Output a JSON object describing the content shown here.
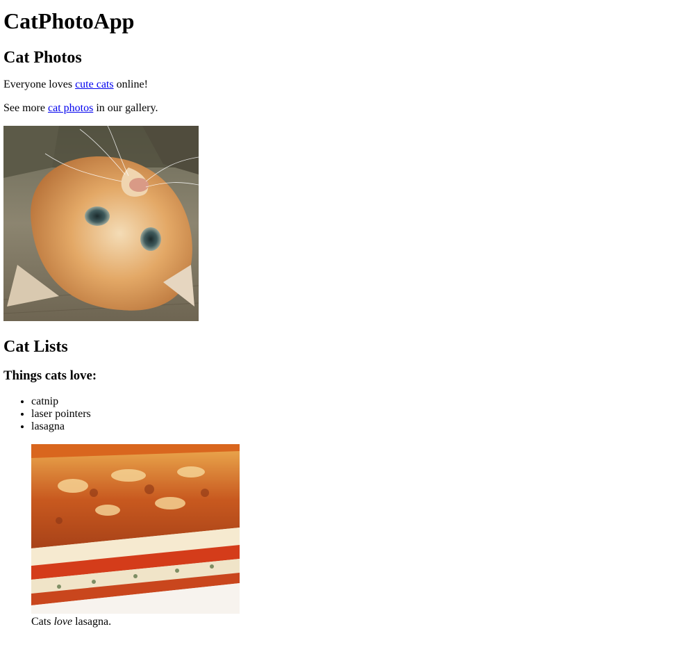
{
  "app_title": "CatPhotoApp",
  "section_photos": {
    "heading": "Cat Photos",
    "p1_before": "Everyone loves ",
    "p1_link": "cute cats",
    "p1_after": " online!",
    "p2_before": "See more ",
    "p2_link": "cat photos",
    "p2_after": " in our gallery."
  },
  "section_lists": {
    "heading": "Cat Lists",
    "subheading": "Things cats love:",
    "items": [
      "catnip",
      "laser pointers",
      "lasagna"
    ],
    "caption_before": "Cats ",
    "caption_em": "love",
    "caption_after": " lasagna."
  }
}
